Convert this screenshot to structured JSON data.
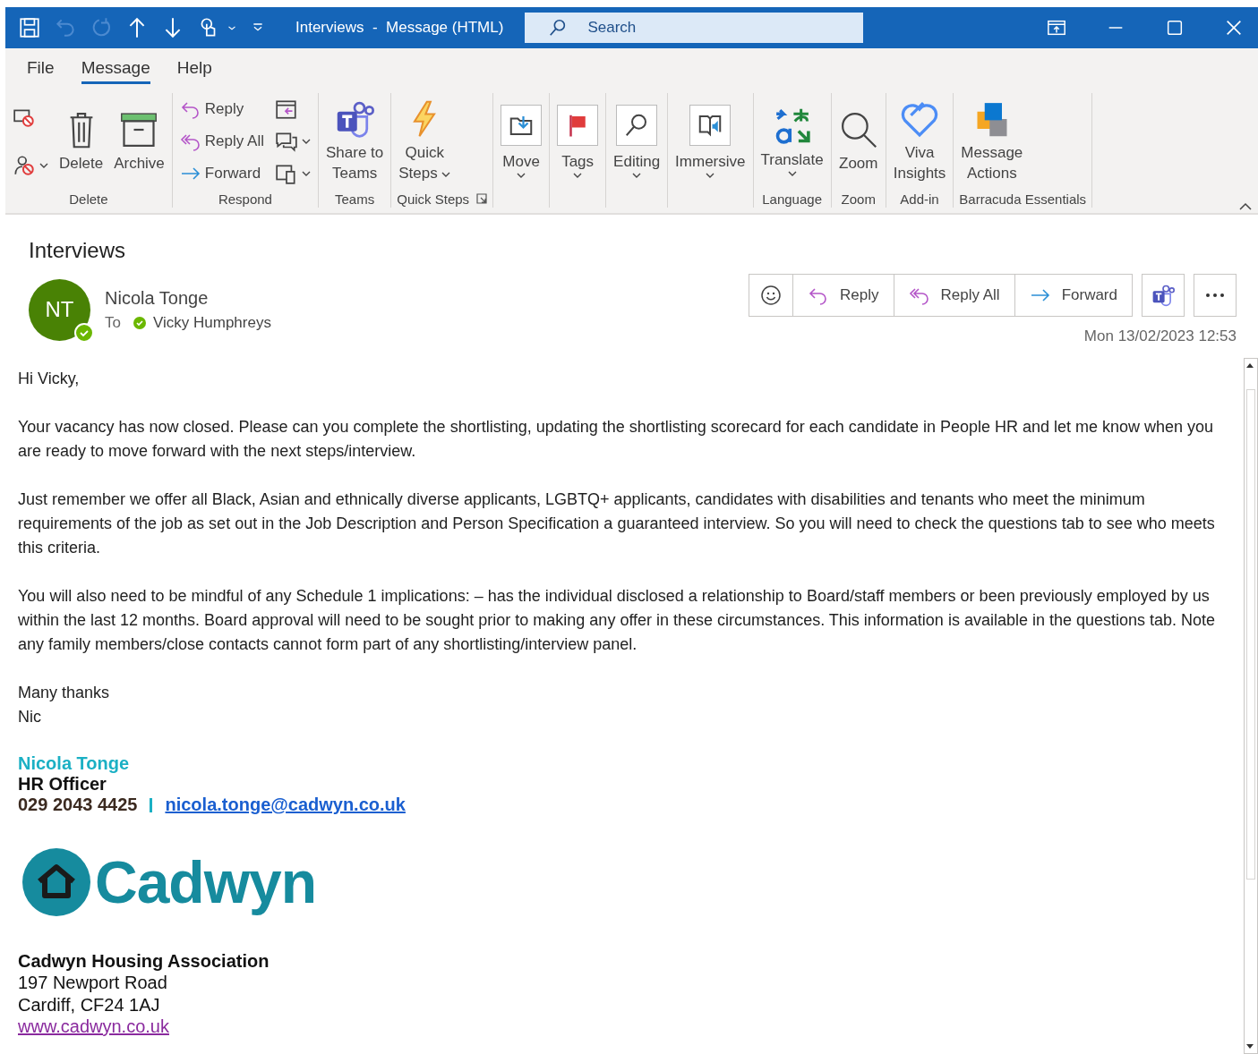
{
  "title_bar": {
    "title": "Interviews  -  Message (HTML)",
    "search": {
      "placeholder": "Search"
    }
  },
  "menu_tabs": [
    {
      "label": "File",
      "selected": false
    },
    {
      "label": "Message",
      "selected": true
    },
    {
      "label": "Help",
      "selected": false
    }
  ],
  "ribbon": {
    "groups": [
      {
        "label": "Delete",
        "columns": [
          [
            {
              "kind": "icon",
              "dropdown": false
            },
            {
              "kind": "icon",
              "dropdown": true
            }
          ],
          [
            {
              "kind": "large",
              "label": "Delete",
              "dropdown": false
            }
          ],
          [
            {
              "kind": "large",
              "label": "Archive",
              "dropdown": false
            }
          ]
        ]
      },
      {
        "label": "Respond",
        "columns": [
          [
            {
              "kind": "small",
              "label": "Reply"
            },
            {
              "kind": "small",
              "label": "Reply All"
            },
            {
              "kind": "small",
              "label": "Forward"
            }
          ],
          [
            {
              "kind": "icon",
              "dropdown": false
            },
            {
              "kind": "icon",
              "dropdown": true
            },
            {
              "kind": "icon",
              "dropdown": true
            }
          ]
        ]
      },
      {
        "label": "Teams",
        "columns": [
          [
            {
              "kind": "large",
              "label": "Share to\nTeams",
              "dropdown": false
            }
          ]
        ]
      },
      {
        "label": "Quick Steps",
        "launcher": true,
        "columns": [
          [
            {
              "kind": "large",
              "label": "Quick\nSteps",
              "dropdown": true
            }
          ]
        ]
      },
      {
        "columns": [
          [
            {
              "kind": "boxed",
              "label": "Move",
              "dropdown": true
            }
          ]
        ]
      },
      {
        "columns": [
          [
            {
              "kind": "boxed",
              "label": "Tags",
              "dropdown": true
            }
          ]
        ]
      },
      {
        "columns": [
          [
            {
              "kind": "boxed",
              "label": "Editing",
              "dropdown": true
            }
          ]
        ]
      },
      {
        "columns": [
          [
            {
              "kind": "boxed",
              "label": "Immersive",
              "dropdown": true
            }
          ]
        ]
      },
      {
        "label": "Language",
        "columns": [
          [
            {
              "kind": "large",
              "label": "Translate",
              "dropdown": true
            }
          ]
        ]
      },
      {
        "label": "Zoom",
        "columns": [
          [
            {
              "kind": "large",
              "label": "Zoom",
              "dropdown": false
            }
          ]
        ]
      },
      {
        "label": "Add-in",
        "columns": [
          [
            {
              "kind": "large",
              "label": "Viva\nInsights",
              "dropdown": false
            }
          ]
        ]
      },
      {
        "label": "Barracuda Essentials",
        "columns": [
          [
            {
              "kind": "large",
              "label": "Message\nActions",
              "dropdown": false
            }
          ]
        ]
      }
    ]
  },
  "message": {
    "subject": "Interviews",
    "sender": {
      "initials": "NT",
      "name": "Nicola Tonge",
      "online": true
    },
    "to_label": "To",
    "recipient": {
      "name": "Vicky Humphreys",
      "online": true
    },
    "actions": [
      {
        "kind": "emoji"
      },
      {
        "kind": "text",
        "label": "Reply"
      },
      {
        "kind": "text",
        "label": "Reply All"
      },
      {
        "kind": "text",
        "label": "Forward"
      },
      {
        "kind": "teams"
      },
      {
        "kind": "more"
      }
    ],
    "date": "Mon 13/02/2023 12:53",
    "body": [
      [
        "Hi Vicky,"
      ],
      [
        "Your vacancy has now closed. Please can you complete the shortlisting, updating the shortlisting scorecard for each candidate in People HR and let me know when you are ready to move forward with the next steps/interview."
      ],
      [
        "Just remember we offer all Black, Asian and ethnically diverse applicants, LGBTQ+ applicants, candidates with disabilities and tenants who meet the minimum requirements of the job as set out in the Job Description and Person Specification a guaranteed interview. So you will need to check the questions tab to see who meets this criteria."
      ],
      [
        "You will also need to be mindful of any Schedule 1 implications: – has the individual disclosed a relationship to Board/staff members or been previously employed by us within the last 12 months. Board approval will need to be sought prior to making any offer in these circumstances. This information is available in the questions tab. Note any family members/close contacts cannot form part of any shortlisting/interview panel."
      ],
      [
        "Many thanks",
        "Nic"
      ]
    ],
    "signature": {
      "name": "Nicola Tonge",
      "job_title": "HR Officer",
      "phone": "029 2043 4425",
      "email": "nicola.tonge@cadwyn.co.uk",
      "logo_text": "Cadwyn",
      "organisation": "Cadwyn Housing Association",
      "address": [
        "197 Newport Road",
        "Cardiff, CF24 1AJ"
      ],
      "website": "www.cadwyn.co.uk"
    }
  }
}
